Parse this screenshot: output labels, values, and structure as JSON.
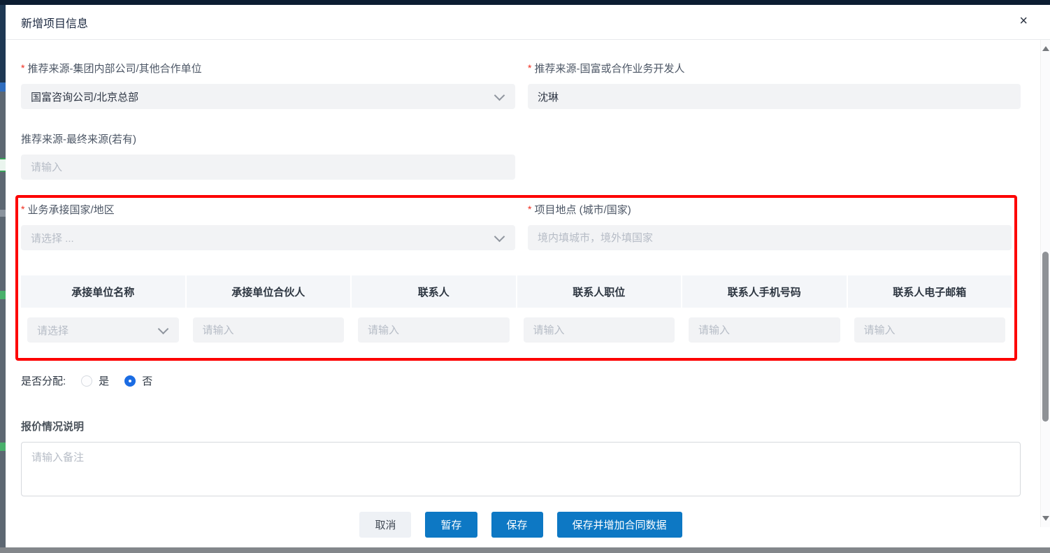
{
  "window": {
    "title": "新增项目信息",
    "icons": {
      "close": "×",
      "chevron": "chevron-down",
      "scroll_up": "triangle-up",
      "scroll_down": "triangle-down"
    }
  },
  "form": {
    "required_marker": "*",
    "rows": {
      "referral_company": {
        "label": "推荐来源-集团内部公司/其他合作单位",
        "required": true,
        "type": "select",
        "value": "国富咨询公司/北京总部"
      },
      "referral_developer": {
        "label": "推荐来源-国富或合作业务开发人",
        "required": true,
        "type": "input",
        "value": "沈琳"
      },
      "referral_final_source": {
        "label": "推荐来源-最终来源(若有)",
        "required": false,
        "type": "input",
        "placeholder": "请输入"
      },
      "business_country": {
        "label": "业务承接国家/地区",
        "required": true,
        "type": "select",
        "placeholder": "请选择 ..."
      },
      "project_location": {
        "label": "项目地点 (城市/国家)",
        "required": true,
        "type": "input",
        "placeholder": "境内填城市，境外填国家"
      }
    },
    "contractor_table": {
      "headers": [
        "承接单位名称",
        "承接单位合伙人",
        "联系人",
        "联系人职位",
        "联系人手机号码",
        "联系人电子邮箱"
      ],
      "row": {
        "unit_name": {
          "type": "select",
          "placeholder": "请选择"
        },
        "unit_partner": {
          "type": "input",
          "placeholder": "请输入"
        },
        "contact": {
          "type": "input",
          "placeholder": "请输入"
        },
        "contact_title": {
          "type": "input",
          "placeholder": "请输入"
        },
        "contact_phone": {
          "type": "input",
          "placeholder": "请输入"
        },
        "contact_email": {
          "type": "input",
          "placeholder": "请输入"
        }
      }
    },
    "allocation": {
      "label": "是否分配:",
      "options": [
        {
          "label": "是",
          "selected": false
        },
        {
          "label": "否",
          "selected": true
        }
      ]
    },
    "quotation": {
      "label": "报价情况说明",
      "placeholder": "请输入备注"
    }
  },
  "footer": {
    "cancel": "取消",
    "stash": "暂存",
    "save": "保存",
    "save_and_add_contract": "保存并增加合同数据"
  },
  "colors": {
    "primary_button": "#0d78c4",
    "radio_selected": "#1b6ce3",
    "required_asterisk": "#f02b1d",
    "highlight_border": "#fd0000",
    "table_header_bg": "#f4f6f9",
    "input_bg": "#f2f3f5",
    "top_strip": "#0c1d32"
  }
}
